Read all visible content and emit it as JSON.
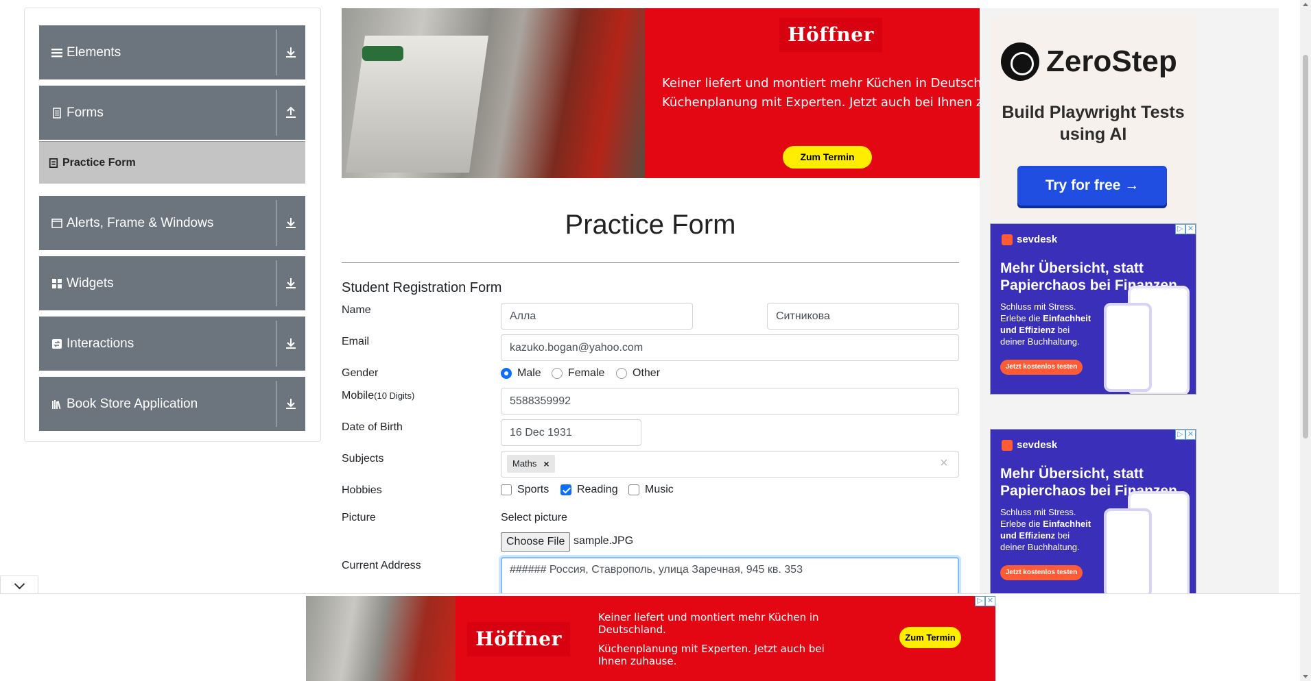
{
  "sidebar": {
    "groups": [
      {
        "label": "Elements",
        "icon": "bars-icon"
      },
      {
        "label": "Forms",
        "icon": "document-icon"
      },
      {
        "label": "Alerts, Frame & Windows",
        "icon": "window-icon"
      },
      {
        "label": "Widgets",
        "icon": "grid-icon"
      },
      {
        "label": "Interactions",
        "icon": "interaction-icon"
      },
      {
        "label": "Book Store Application",
        "icon": "books-icon"
      }
    ],
    "active_item": "Practice Form"
  },
  "top_ad": {
    "brand": "Höffner",
    "line1": "Keiner liefert und montiert mehr Küchen in Deutschland.",
    "line2": "Küchenplanung mit Experten. Jetzt auch bei Ihnen zuhause.",
    "cta": "Zum Termin"
  },
  "zerostep_ad": {
    "brand": "ZeroStep",
    "tagline": "Build Playwright Tests using AI",
    "cta": "Try for free →"
  },
  "sevdesk_ad": {
    "brand": "sevdesk",
    "headline": "Mehr Übersicht, statt Papierchaos bei Finanzen.",
    "body_pre": "Schluss mit Stress. Erlebe die ",
    "body_bold": "Einfachheit und Effizienz",
    "body_post": " bei deiner Buchhaltung.",
    "cta": "Jetzt kostenlos testen"
  },
  "form": {
    "title": "Practice Form",
    "subtitle": "Student Registration Form",
    "labels": {
      "name": "Name",
      "email": "Email",
      "gender": "Gender",
      "mobile": "Mobile",
      "mobile_hint": "(10 Digits)",
      "dob": "Date of Birth",
      "subjects": "Subjects",
      "hobbies": "Hobbies",
      "picture": "Picture",
      "address": "Current Address"
    },
    "first_name": "Алла",
    "last_name": "Ситникова",
    "email": "kazuko.bogan@yahoo.com",
    "gender_options": [
      "Male",
      "Female",
      "Other"
    ],
    "gender_selected": "Male",
    "mobile": "5588359992",
    "dob": "16 Dec 1931",
    "subjects": [
      "Maths"
    ],
    "hobby_options": [
      "Sports",
      "Reading",
      "Music"
    ],
    "hobbies_checked": [
      "Reading"
    ],
    "picture_label": "Select picture",
    "file_button": "Choose File",
    "file_name": "sample.JPG",
    "current_address": "###### Россия, Ставрополь, улица Заречная, 945 кв. 353"
  },
  "bottom_ad": {
    "brand": "Höffner",
    "line1": "Keiner liefert und montiert mehr Küchen in Deutschland.",
    "line2": "Küchenplanung mit Experten. Jetzt auch bei Ihnen zuhause.",
    "cta": "Zum Termin"
  },
  "colors": {
    "sidebar_group_bg": "#6c757d",
    "active_item_bg": "#c4c4c4",
    "hoffner_red": "#e30613",
    "cta_yellow": "#ffed00",
    "zerostep_blue": "#1f4ee0",
    "sevdesk_purple": "#3a2fb8",
    "sevdesk_orange": "#ff5c35",
    "focus_blue": "#80bdff"
  }
}
